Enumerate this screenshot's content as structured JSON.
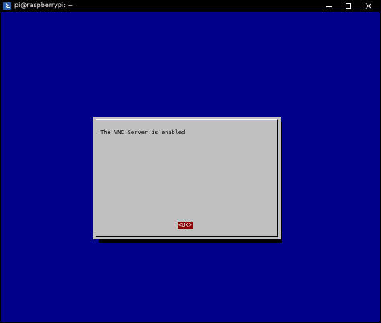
{
  "window": {
    "title": "pi@raspberrypi: ~",
    "icon": "terminal-icon"
  },
  "dialog": {
    "message": "The VNC Server is enabled",
    "ok_label": "<Ok>"
  },
  "colors": {
    "terminal_background": "#00008b",
    "dialog_background": "#c0c0c0",
    "button_selected": "#8b0000",
    "titlebar": "#000000"
  }
}
